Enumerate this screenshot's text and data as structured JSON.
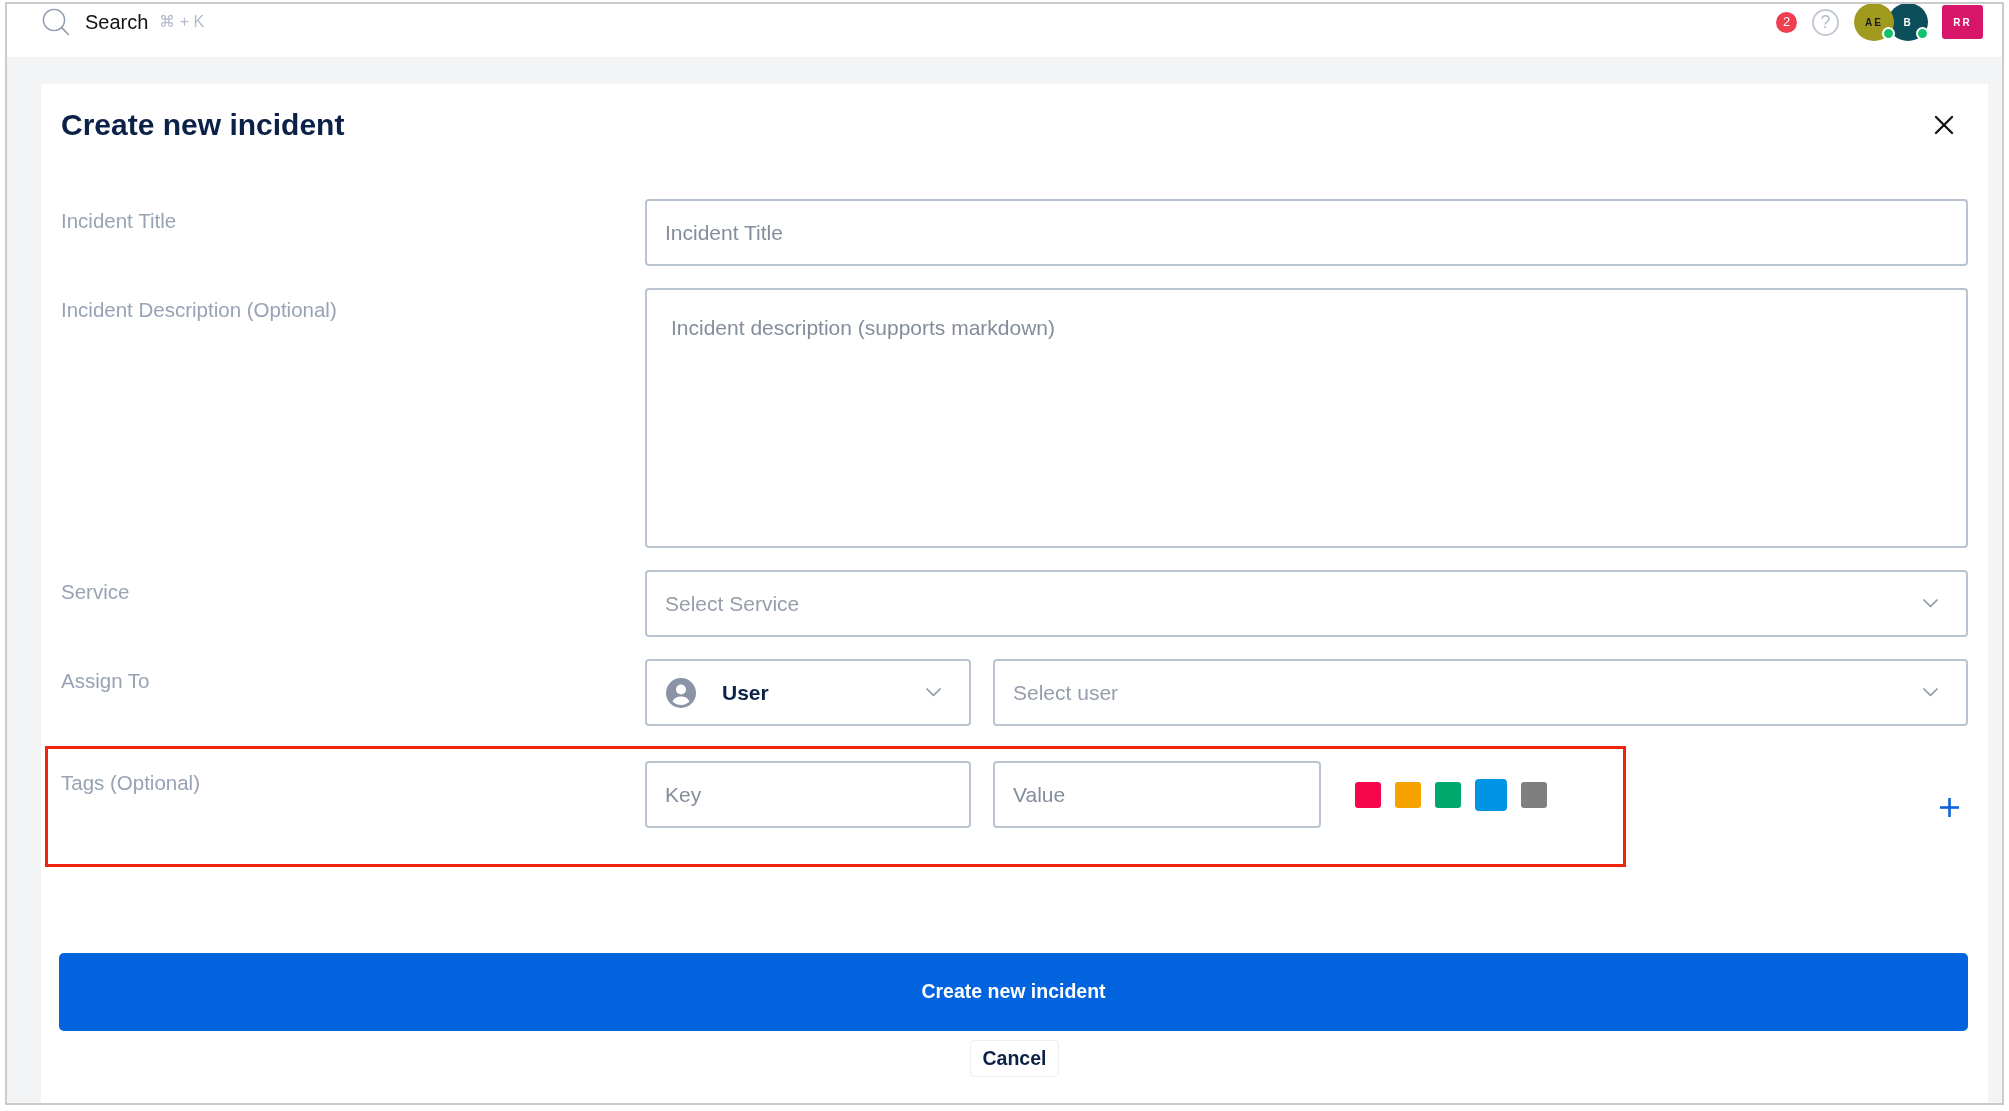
{
  "topbar": {
    "search": {
      "label": "Search",
      "shortcut": "⌘ + K"
    },
    "notification_count": "2",
    "help": "?",
    "avatars": [
      {
        "initials": "AE",
        "kind": "circle",
        "color": "#a09a1f",
        "online": true
      },
      {
        "initials": "B",
        "kind": "circle",
        "color": "#0c4e5a",
        "online": true
      },
      {
        "initials": "RR",
        "kind": "square",
        "color": "#d7166a",
        "online": false
      }
    ]
  },
  "dialog": {
    "title": "Create new incident",
    "fields": [
      {
        "kind": "text",
        "label": "Incident Title",
        "placeholder": "Incident Title"
      },
      {
        "kind": "textarea",
        "label": "Incident Description (Optional)",
        "placeholder": "Incident description (supports markdown)"
      },
      {
        "kind": "select",
        "label": "Service",
        "placeholder": "Select Service"
      },
      {
        "kind": "assign",
        "label": "Assign To",
        "assignee_type": {
          "value": "User"
        },
        "user_select": {
          "placeholder": "Select user"
        }
      },
      {
        "kind": "tags",
        "label": "Tags (Optional)",
        "highlighted": true,
        "key_field": {
          "placeholder": "Key"
        },
        "value_field": {
          "placeholder": "Value"
        },
        "colors": [
          {
            "color": "#f7064d",
            "selected": false
          },
          {
            "color": "#f6a300",
            "selected": false
          },
          {
            "color": "#00a86b",
            "selected": false
          },
          {
            "color": "#0095e4",
            "selected": true
          },
          {
            "color": "#7f7f7f",
            "selected": false
          }
        ]
      }
    ],
    "submit_button": "Create new incident",
    "cancel_button": "Cancel"
  }
}
